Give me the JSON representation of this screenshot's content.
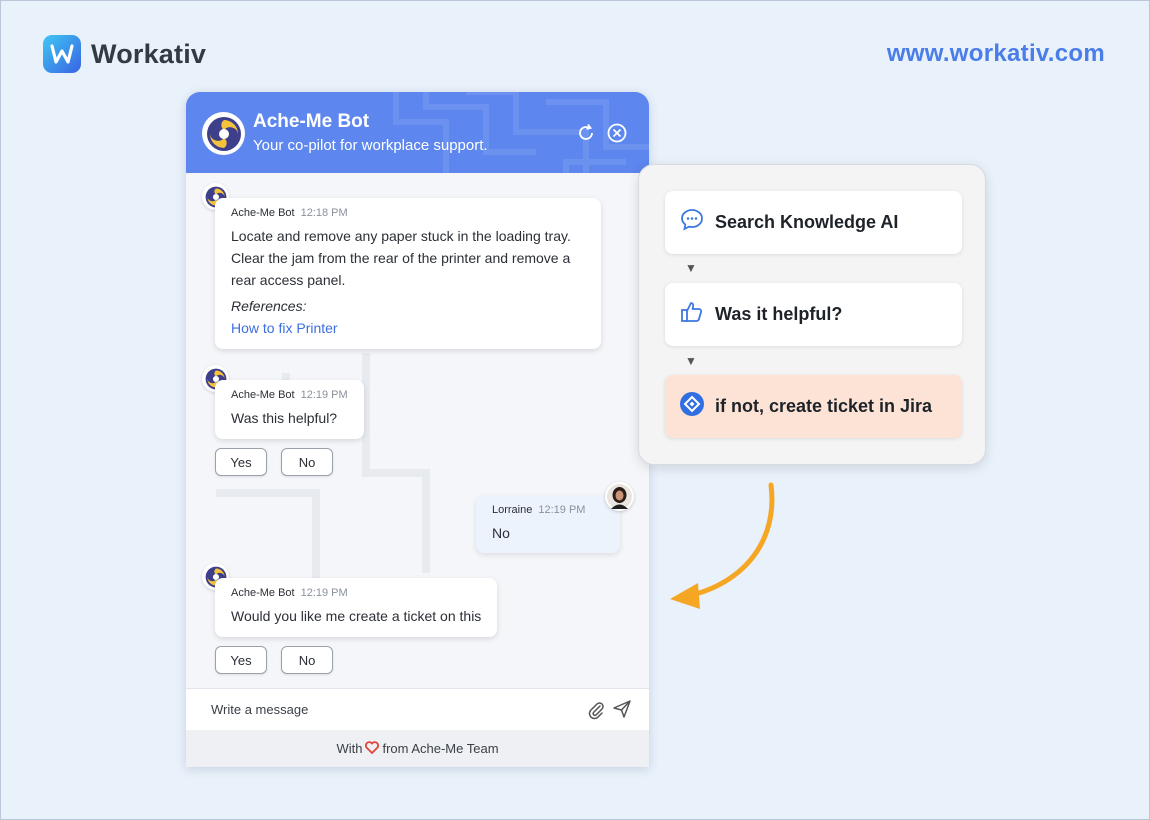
{
  "brand": {
    "name": "Workativ",
    "url": "www.workativ.com"
  },
  "chat": {
    "header": {
      "title": "Ache-Me Bot",
      "subtitle": "Your co-pilot for workplace support."
    },
    "messages": [
      {
        "sender": "Ache-Me Bot",
        "time": "12:18 PM",
        "text": "Locate and remove any paper stuck in the loading tray. Clear the jam from the rear of the printer and remove a rear access panel.",
        "references_label": "References:",
        "reference_link": "How to fix Printer"
      },
      {
        "sender": "Ache-Me Bot",
        "time": "12:19 PM",
        "text": "Was this helpful?",
        "options": [
          "Yes",
          "No"
        ]
      },
      {
        "sender": "Lorraine",
        "time": "12:19 PM",
        "text": "No"
      },
      {
        "sender": "Ache-Me Bot",
        "time": "12:19 PM",
        "text": "Would you like me create a ticket on this",
        "options": [
          "Yes",
          "No"
        ]
      }
    ],
    "input": {
      "placeholder": "Write a message"
    },
    "footer": {
      "prefix": "With",
      "suffix": "from Ache-Me Team"
    }
  },
  "flow": {
    "steps": [
      {
        "label": "Search Knowledge AI",
        "icon": "chat-bubble-icon"
      },
      {
        "label": "Was it helpful?",
        "icon": "thumbs-up-icon"
      },
      {
        "label": "if not, create ticket in Jira",
        "icon": "jira-icon"
      }
    ],
    "connector": "▼"
  },
  "colors": {
    "header": "#5d86ee",
    "accent": "#4a7de8",
    "jira_step": "#fde3d6",
    "arrow": "#f5a623",
    "link": "#3b6fe0"
  }
}
